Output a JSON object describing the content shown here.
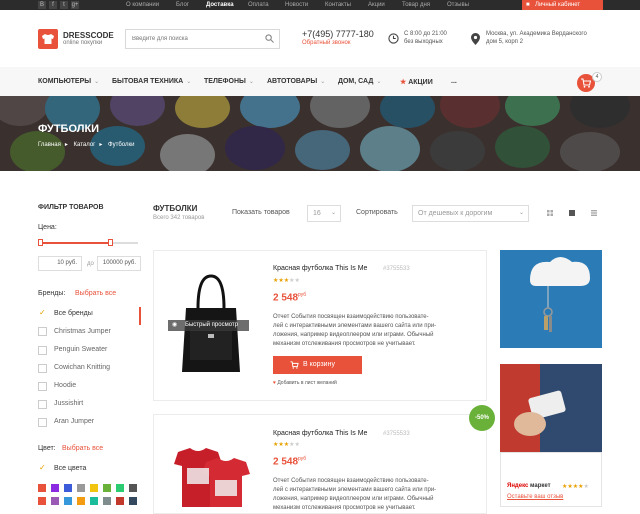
{
  "topbar": {
    "social": [
      "В",
      "f",
      "t",
      "g+"
    ],
    "nav": [
      "О компании",
      "Блог",
      "Доставка",
      "Оплата",
      "Новости",
      "Контакты",
      "Акции",
      "Товар дня",
      "Отзывы"
    ],
    "active_nav": "Доставка",
    "cabinet": "Личный кабинет"
  },
  "header": {
    "logo_title": "DRESSCODE",
    "logo_sub": "online покупки",
    "search_placeholder": "Введите для поиска",
    "phone": "+7(495) 7777-180",
    "callback": "Обратный звонок",
    "hours_line1": "С 8:00 до 21:00",
    "hours_line2": "без выходных",
    "address_line1": "Москва, ул. Академика Верданского",
    "address_line2": "дом 5, корп 2"
  },
  "menu": {
    "items": [
      "КОМПЬЮТЕРЫ",
      "БЫТОВАЯ ТЕХНИКА",
      "ТЕЛЕФОНЫ",
      "АВТОТОВАРЫ",
      "ДОМ, САД",
      "АКЦИИ",
      "..."
    ],
    "cart_count": "4"
  },
  "hero": {
    "title": "ФУТБОЛКИ",
    "breadcrumb": [
      "Главная",
      "Каталог",
      "Футболки"
    ]
  },
  "filter": {
    "title": "ФИЛЬТР ТОВАРОВ",
    "price_label": "Цена:",
    "price_from": "10 руб.",
    "price_sep": "до",
    "price_to": "100000 руб.",
    "brands_label": "Бренды:",
    "select_all": "Выбрать все",
    "brands": [
      {
        "label": "Все бренды",
        "checked": true
      },
      {
        "label": "Christmas Jumper",
        "checked": false
      },
      {
        "label": "Penguin Sweater",
        "checked": false
      },
      {
        "label": "Cowichan Knitting",
        "checked": false
      },
      {
        "label": "Hoodie",
        "checked": false
      },
      {
        "label": "Jussishirt",
        "checked": false
      },
      {
        "label": "Aran Jumper",
        "checked": false
      }
    ],
    "color_label": "Цвет:",
    "color_select_all": "Выбрать все",
    "all_colors": "Все цвета",
    "swatches": [
      "#e8523a",
      "#8a2be2",
      "#3b5bdb",
      "#999999",
      "#f1c40f",
      "#6ab139",
      "#2ecc71",
      "#555555",
      "#e8523a",
      "#9b59b6",
      "#3498db",
      "#f39c12",
      "#1abc9c",
      "#7f8c8d",
      "#c0392b",
      "#34495e"
    ]
  },
  "listing": {
    "title": "ФУТБОЛКИ",
    "count": "Всего 342 товаров",
    "show_label": "Показать товаров",
    "show_value": "16",
    "sort_label": "Сортировать",
    "sort_value": "От дешевых к дорогим"
  },
  "products": [
    {
      "name": "Красная футболка This Is Me",
      "sku": "#3755533",
      "rating": 3,
      "price": "2 548",
      "currency": "руб",
      "description": [
        "Отчет События посвящен взаимодействию пользовате-",
        "лей с интерактивными элементами вашего сайта или при-",
        "ложения, например видеоплеером или играми. Обычный",
        "механизм отслеживания просмотров не учитывает."
      ],
      "buy": "В корзину",
      "wish": "Добавить в лист желаний",
      "quickview": "Быстрый просмотр"
    },
    {
      "name": "Красная футболка This Is Me",
      "sku": "#3755533",
      "rating": 3,
      "price": "2 548",
      "currency": "руб",
      "description": [
        "Отчет События посвящен взаимодействию пользовате-",
        "лей с интерактивными элементами вашего сайта или при-",
        "ложения, например видеоплеером или играми. Обычный",
        "механизм отслеживания просмотров не учитывает."
      ],
      "sale": "-50%"
    }
  ],
  "market": {
    "brand": "Яндекс",
    "title": "маркет",
    "review_link": "Оставьте ваш отзыв",
    "rating": 4
  }
}
